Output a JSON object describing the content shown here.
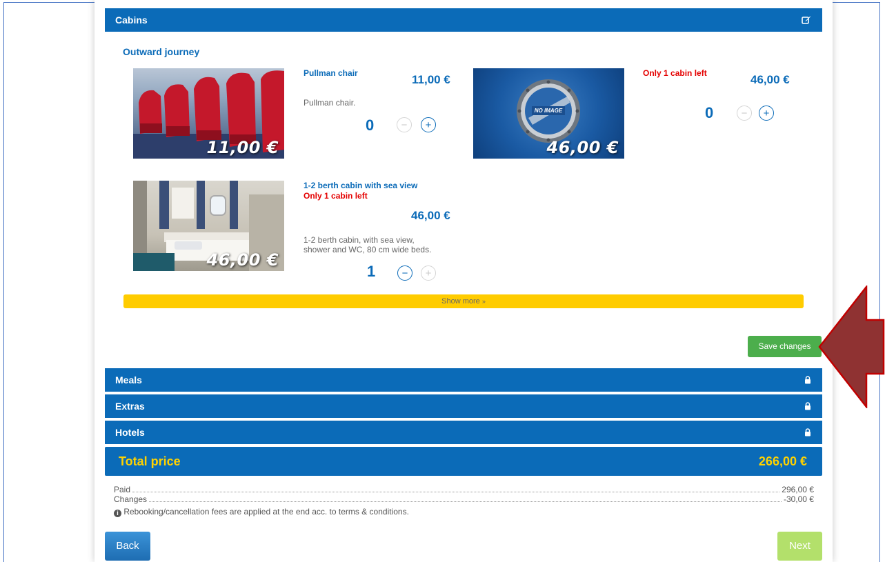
{
  "cabins_section": {
    "title": "Cabins",
    "edit_icon": "edit-icon"
  },
  "outward": {
    "title": "Outward journey"
  },
  "items": [
    {
      "name": "Pullman chair",
      "price": "11,00 €",
      "description": "Pullman chair.",
      "quantity": "0",
      "image_price": "11,00 €"
    },
    {
      "name": "",
      "availability": "Only 1 cabin left",
      "price": "46,00 €",
      "quantity": "0",
      "image_price": "46,00 €",
      "image_text": "NO IMAGE"
    },
    {
      "name": "1-2 berth cabin with sea view",
      "availability": "Only 1 cabin left",
      "price": "46,00 €",
      "description_line1": "1-2 berth cabin, with sea view,",
      "description_line2": "shower and WC, 80 cm wide beds.",
      "quantity": "1",
      "image_price": "46,00 €"
    }
  ],
  "show_more": "Show more ",
  "save_changes": "Save changes",
  "sections": [
    {
      "title": "Meals",
      "icon": "lock-icon"
    },
    {
      "title": "Extras",
      "icon": "lock-icon"
    },
    {
      "title": "Hotels",
      "icon": "lock-icon"
    }
  ],
  "total": {
    "label": "Total price",
    "value": "266,00 €"
  },
  "summary": {
    "paid_label": "Paid",
    "paid_value": "296,00 €",
    "changes_label": "Changes",
    "changes_value": "-30,00 €",
    "note": "Rebooking/cancellation fees are applied at the end acc. to terms & conditions."
  },
  "nav": {
    "back": "Back",
    "next": "Next"
  },
  "colors": {
    "primary": "#0b6bb8",
    "accent_yellow": "#ffcc00",
    "save_green": "#4cae4c",
    "warning_red": "#e40000",
    "arrow": "#8f3232"
  }
}
